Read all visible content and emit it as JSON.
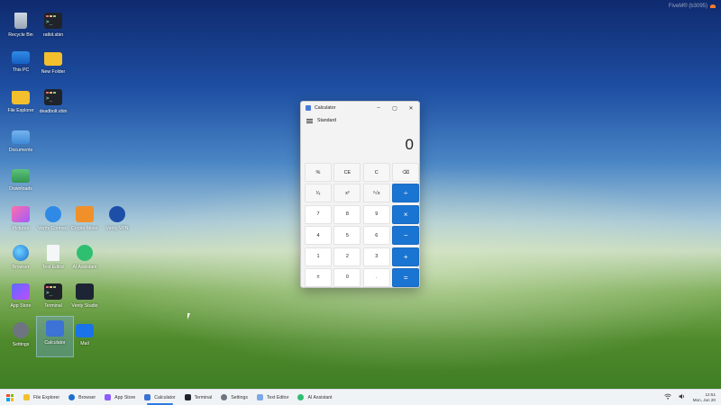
{
  "watermark": {
    "text": "FiveM® (b3095)"
  },
  "desktop_icons": [
    {
      "label": "Recycle Bin",
      "icon": "recycle-bin-icon"
    },
    {
      "label": "ratkit.sbin",
      "icon": "terminal-file-icon"
    },
    {
      "label": "This PC",
      "icon": "monitor-icon"
    },
    {
      "label": "New Folder",
      "icon": "folder-icon"
    },
    {
      "label": "File Explorer",
      "icon": "folder-icon"
    },
    {
      "label": "deadbolt.vbin",
      "icon": "terminal-file-icon"
    },
    {
      "label": "Documents",
      "icon": "documents-folder-icon"
    },
    {
      "label": "Downloads",
      "icon": "downloads-folder-icon"
    },
    {
      "label": "Pictures",
      "icon": "pictures-folder-icon"
    },
    {
      "label": "Venty Connect",
      "icon": "chat-icon"
    },
    {
      "label": "Crypto Miner",
      "icon": "miner-icon"
    },
    {
      "label": "Venty VPN",
      "icon": "vpn-shield-icon"
    },
    {
      "label": "Browser",
      "icon": "globe-icon"
    },
    {
      "label": "Text Editor",
      "icon": "notepad-icon"
    },
    {
      "label": "AI Assistant",
      "icon": "ai-chat-icon"
    },
    {
      "label": "App Store",
      "icon": "store-icon"
    },
    {
      "label": "Terminal",
      "icon": "terminal-icon"
    },
    {
      "label": "Venty Studio",
      "icon": "studio-icon"
    },
    {
      "label": "Settings",
      "icon": "gear-icon"
    },
    {
      "label": "Calculator",
      "icon": "calculator-icon"
    },
    {
      "label": "Mail",
      "icon": "mail-icon"
    }
  ],
  "calculator": {
    "title": "Calculator",
    "mode": "Standard",
    "display": "0",
    "controls": {
      "minimize": "–",
      "maximize": "▢",
      "close": "✕"
    },
    "keys": [
      [
        "%",
        "CE",
        "C",
        "⌫"
      ],
      [
        "¹⁄ₓ",
        "x²",
        "²√x",
        "÷"
      ],
      [
        "7",
        "8",
        "9",
        "×"
      ],
      [
        "4",
        "5",
        "6",
        "−"
      ],
      [
        "1",
        "2",
        "3",
        "+"
      ],
      [
        "±",
        "0",
        ".",
        "="
      ]
    ]
  },
  "taskbar": {
    "items": [
      {
        "label": "File Explorer",
        "color": "#f3bf2c"
      },
      {
        "label": "Browser",
        "color": "#1c6fd0"
      },
      {
        "label": "App Store",
        "color": "#8b5cff"
      },
      {
        "label": "Calculator",
        "color": "#3d72d6"
      },
      {
        "label": "Terminal",
        "color": "#20232a"
      },
      {
        "label": "Settings",
        "color": "#6e7480"
      },
      {
        "label": "Text Editor",
        "color": "#7aa7e8"
      },
      {
        "label": "AI Assistant",
        "color": "#2fbf71"
      }
    ],
    "tray": {
      "wifi": "wifi-icon",
      "volume": "volume-icon"
    },
    "clock": {
      "time": "12:51",
      "date": "Mon, Jun 20"
    }
  },
  "colors": {
    "accent": "#1a74d1"
  }
}
